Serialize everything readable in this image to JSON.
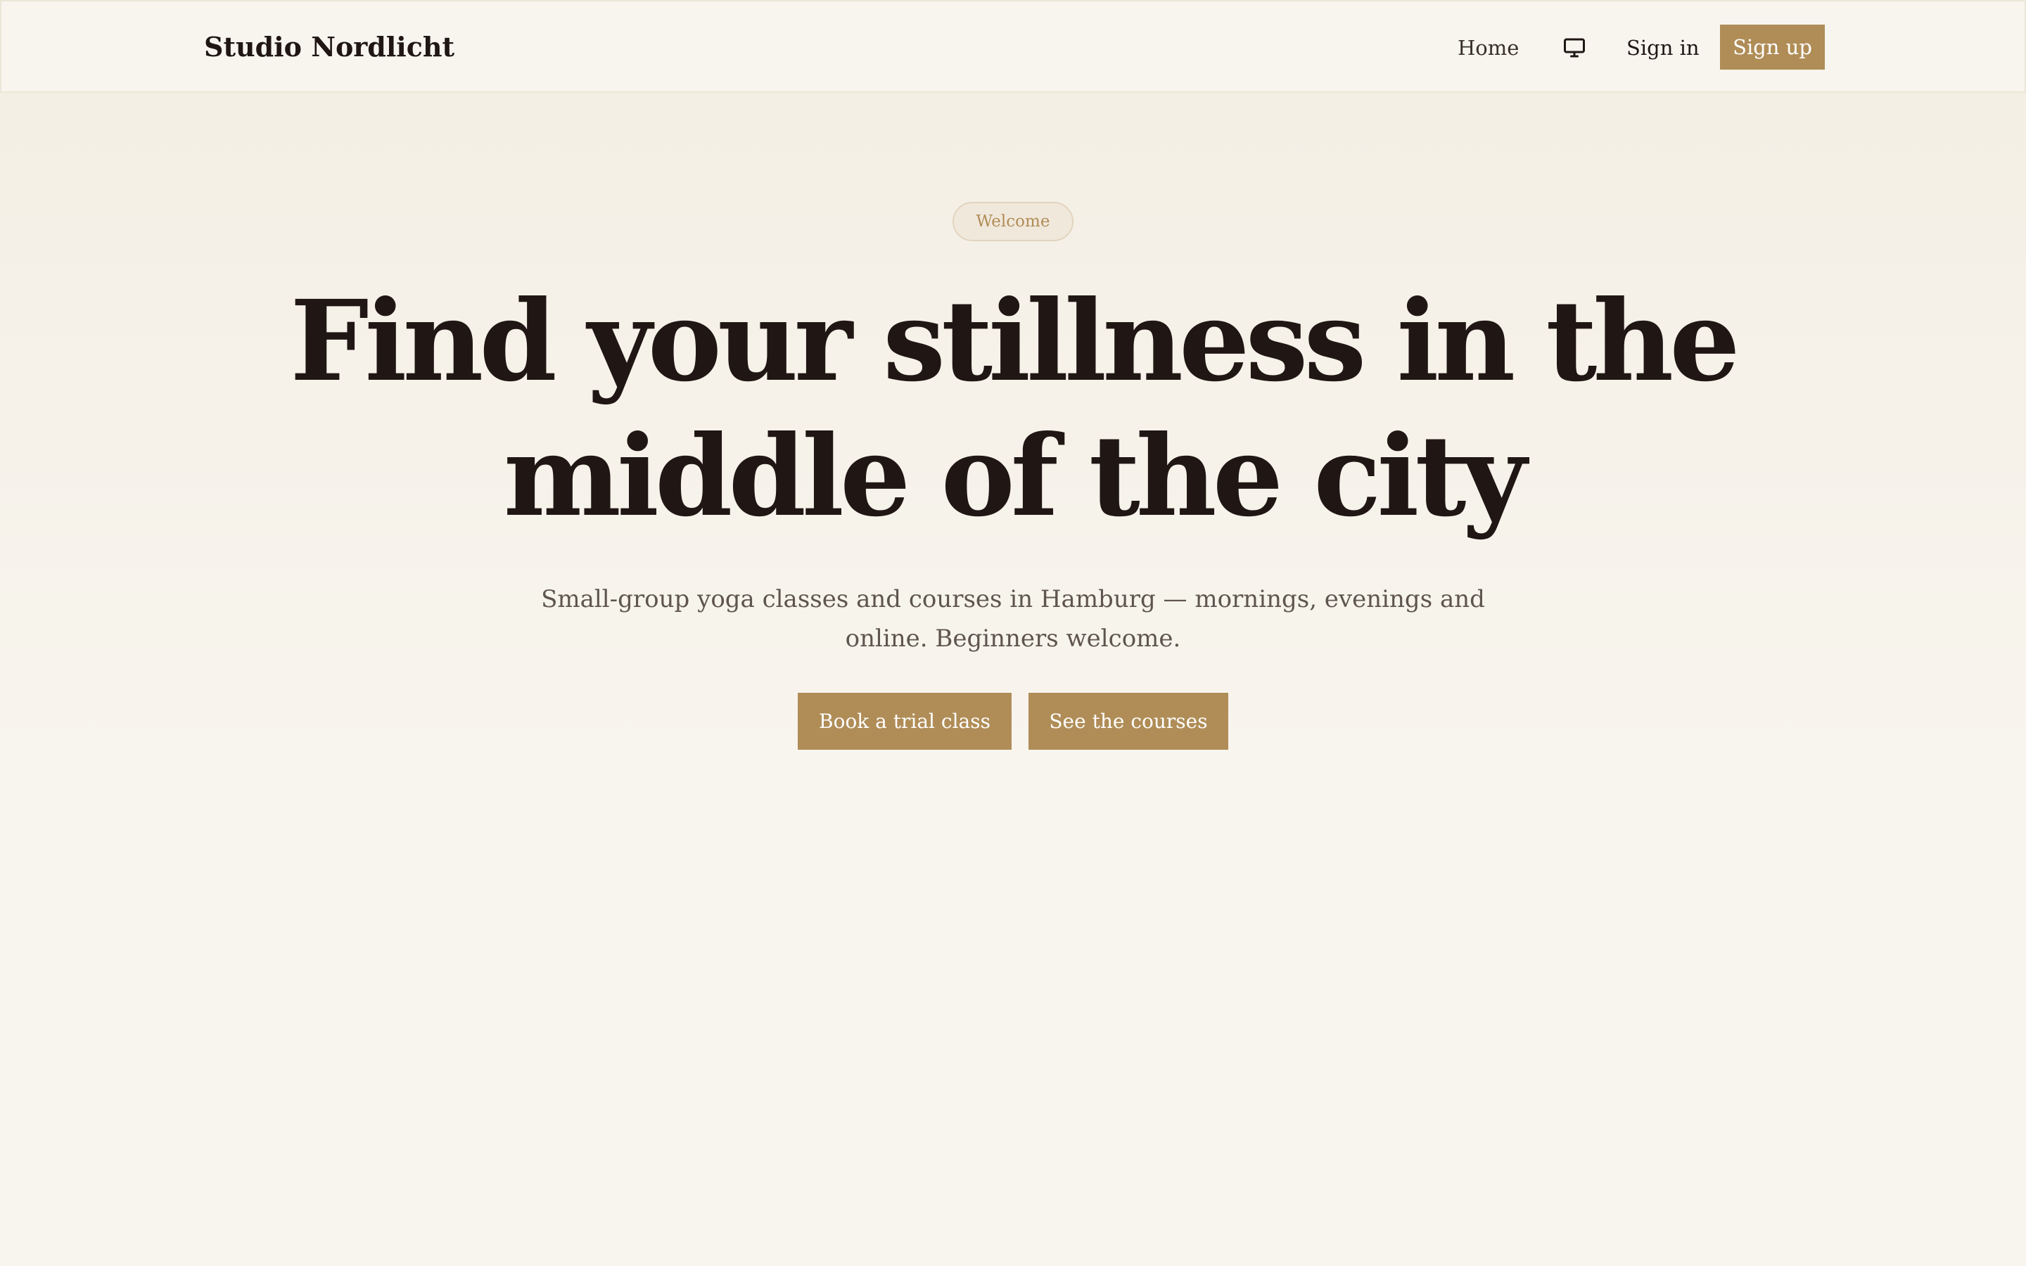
{
  "header": {
    "brand": "Studio Nordlicht",
    "nav": {
      "home": "Home",
      "display_icon": "monitor-icon",
      "sign_in": "Sign in",
      "sign_up": "Sign up"
    }
  },
  "hero": {
    "badge": "Welcome",
    "title": "Find your stillness in the middle of the city",
    "subtitle": "Small-group yoga classes and courses in Hamburg — mornings, evenings and online. Beginners welcome.",
    "primary_button": "Book a trial class",
    "secondary_button": "See the courses"
  },
  "colors": {
    "accent": "#b08d57",
    "text_dark": "#201714",
    "text_muted": "#5e554e",
    "background": "#f8f5ee",
    "navbar_background": "#f7f5ee",
    "badge_background": "#f1e8dc"
  }
}
